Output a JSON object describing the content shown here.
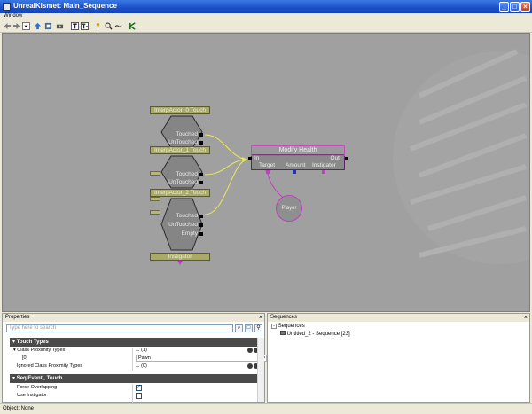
{
  "window": {
    "title": "UnrealKismet: Main_Sequence"
  },
  "menu": {
    "items": [
      "Window"
    ]
  },
  "canvas": {
    "nodes": {
      "touch0": {
        "title": "InterpActor_0 Touch",
        "outputs": [
          "Touched",
          "UnTouched"
        ]
      },
      "touch1": {
        "title": "InterpActor_1 Touch",
        "outputs": [
          "Touched",
          "UnTouched"
        ]
      },
      "touch2": {
        "title": "InterpActor_2 Touch",
        "outputs": [
          "Touched",
          "UnTouched",
          "Empty"
        ],
        "footer": "Instigator"
      },
      "modify_health": {
        "title": "Modify Health",
        "in": "In",
        "out": "Out",
        "vars": [
          "Target",
          "Amount",
          "Instigator"
        ]
      },
      "player_var": {
        "label": "Player"
      }
    }
  },
  "properties": {
    "title": "Properties",
    "search_placeholder": "Type here to search",
    "categories": [
      {
        "label": "Touch Types",
        "rows": [
          {
            "name": "Class Proximity Types",
            "value": "... (1)"
          },
          {
            "name": "[0]",
            "value": "Pawn"
          },
          {
            "name": "Ignored Class Proximity Types",
            "value": "... (0)"
          }
        ]
      },
      {
        "label": "Seq Event_ Touch",
        "rows": [
          {
            "name": "Force Overlapping",
            "checked": true
          },
          {
            "name": "Use Instigator",
            "checked": false
          }
        ]
      }
    ]
  },
  "sequences": {
    "title": "Sequences",
    "root": "Sequences",
    "child": "Untitled_2 - Sequence [23]"
  },
  "status": {
    "text": "Object: None"
  },
  "colors": {
    "titlebar": "#1a4fc9",
    "canvas": "#a0a0a0",
    "link_yellow": "#e8e85a",
    "link_magenta": "#c040c0"
  }
}
